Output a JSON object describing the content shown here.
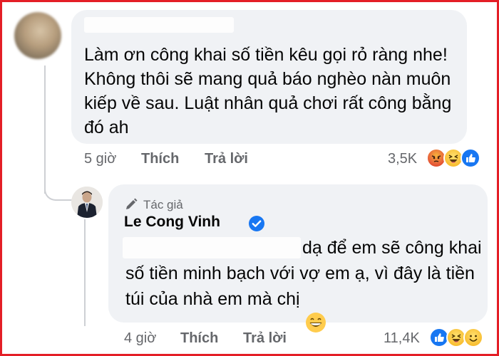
{
  "comment": {
    "text": "Làm ơn công khai số tiền kêu gọi rỏ ràng nhe! Không thôi sẽ mang quả báo nghèo nàn muôn kiếp về sau. Luật nhân quả chơi rất công bằng đó ah",
    "time": "5 giờ",
    "like_label": "Thích",
    "reply_label": "Trả lời",
    "reaction_count": "3,5K",
    "reactions": [
      "angry-icon",
      "haha-icon",
      "like-icon"
    ]
  },
  "reply": {
    "author_badge": "Tác giả",
    "author_name": "Le Cong Vinh",
    "text": "dạ để em sẽ công khai số tiền minh bạch với vợ em ạ, vì đây là tiền túi của nhà em mà chị",
    "time": "4 giờ",
    "like_label": "Thích",
    "reply_label": "Trả lời",
    "reaction_count": "11,4K",
    "reactions": [
      "like-icon",
      "haha-icon",
      "love-icon"
    ]
  },
  "colors": {
    "bubble": "#f0f2f5",
    "meta_text": "#65676b",
    "verified": "#1877f2",
    "frame_border": "#e41e26"
  }
}
